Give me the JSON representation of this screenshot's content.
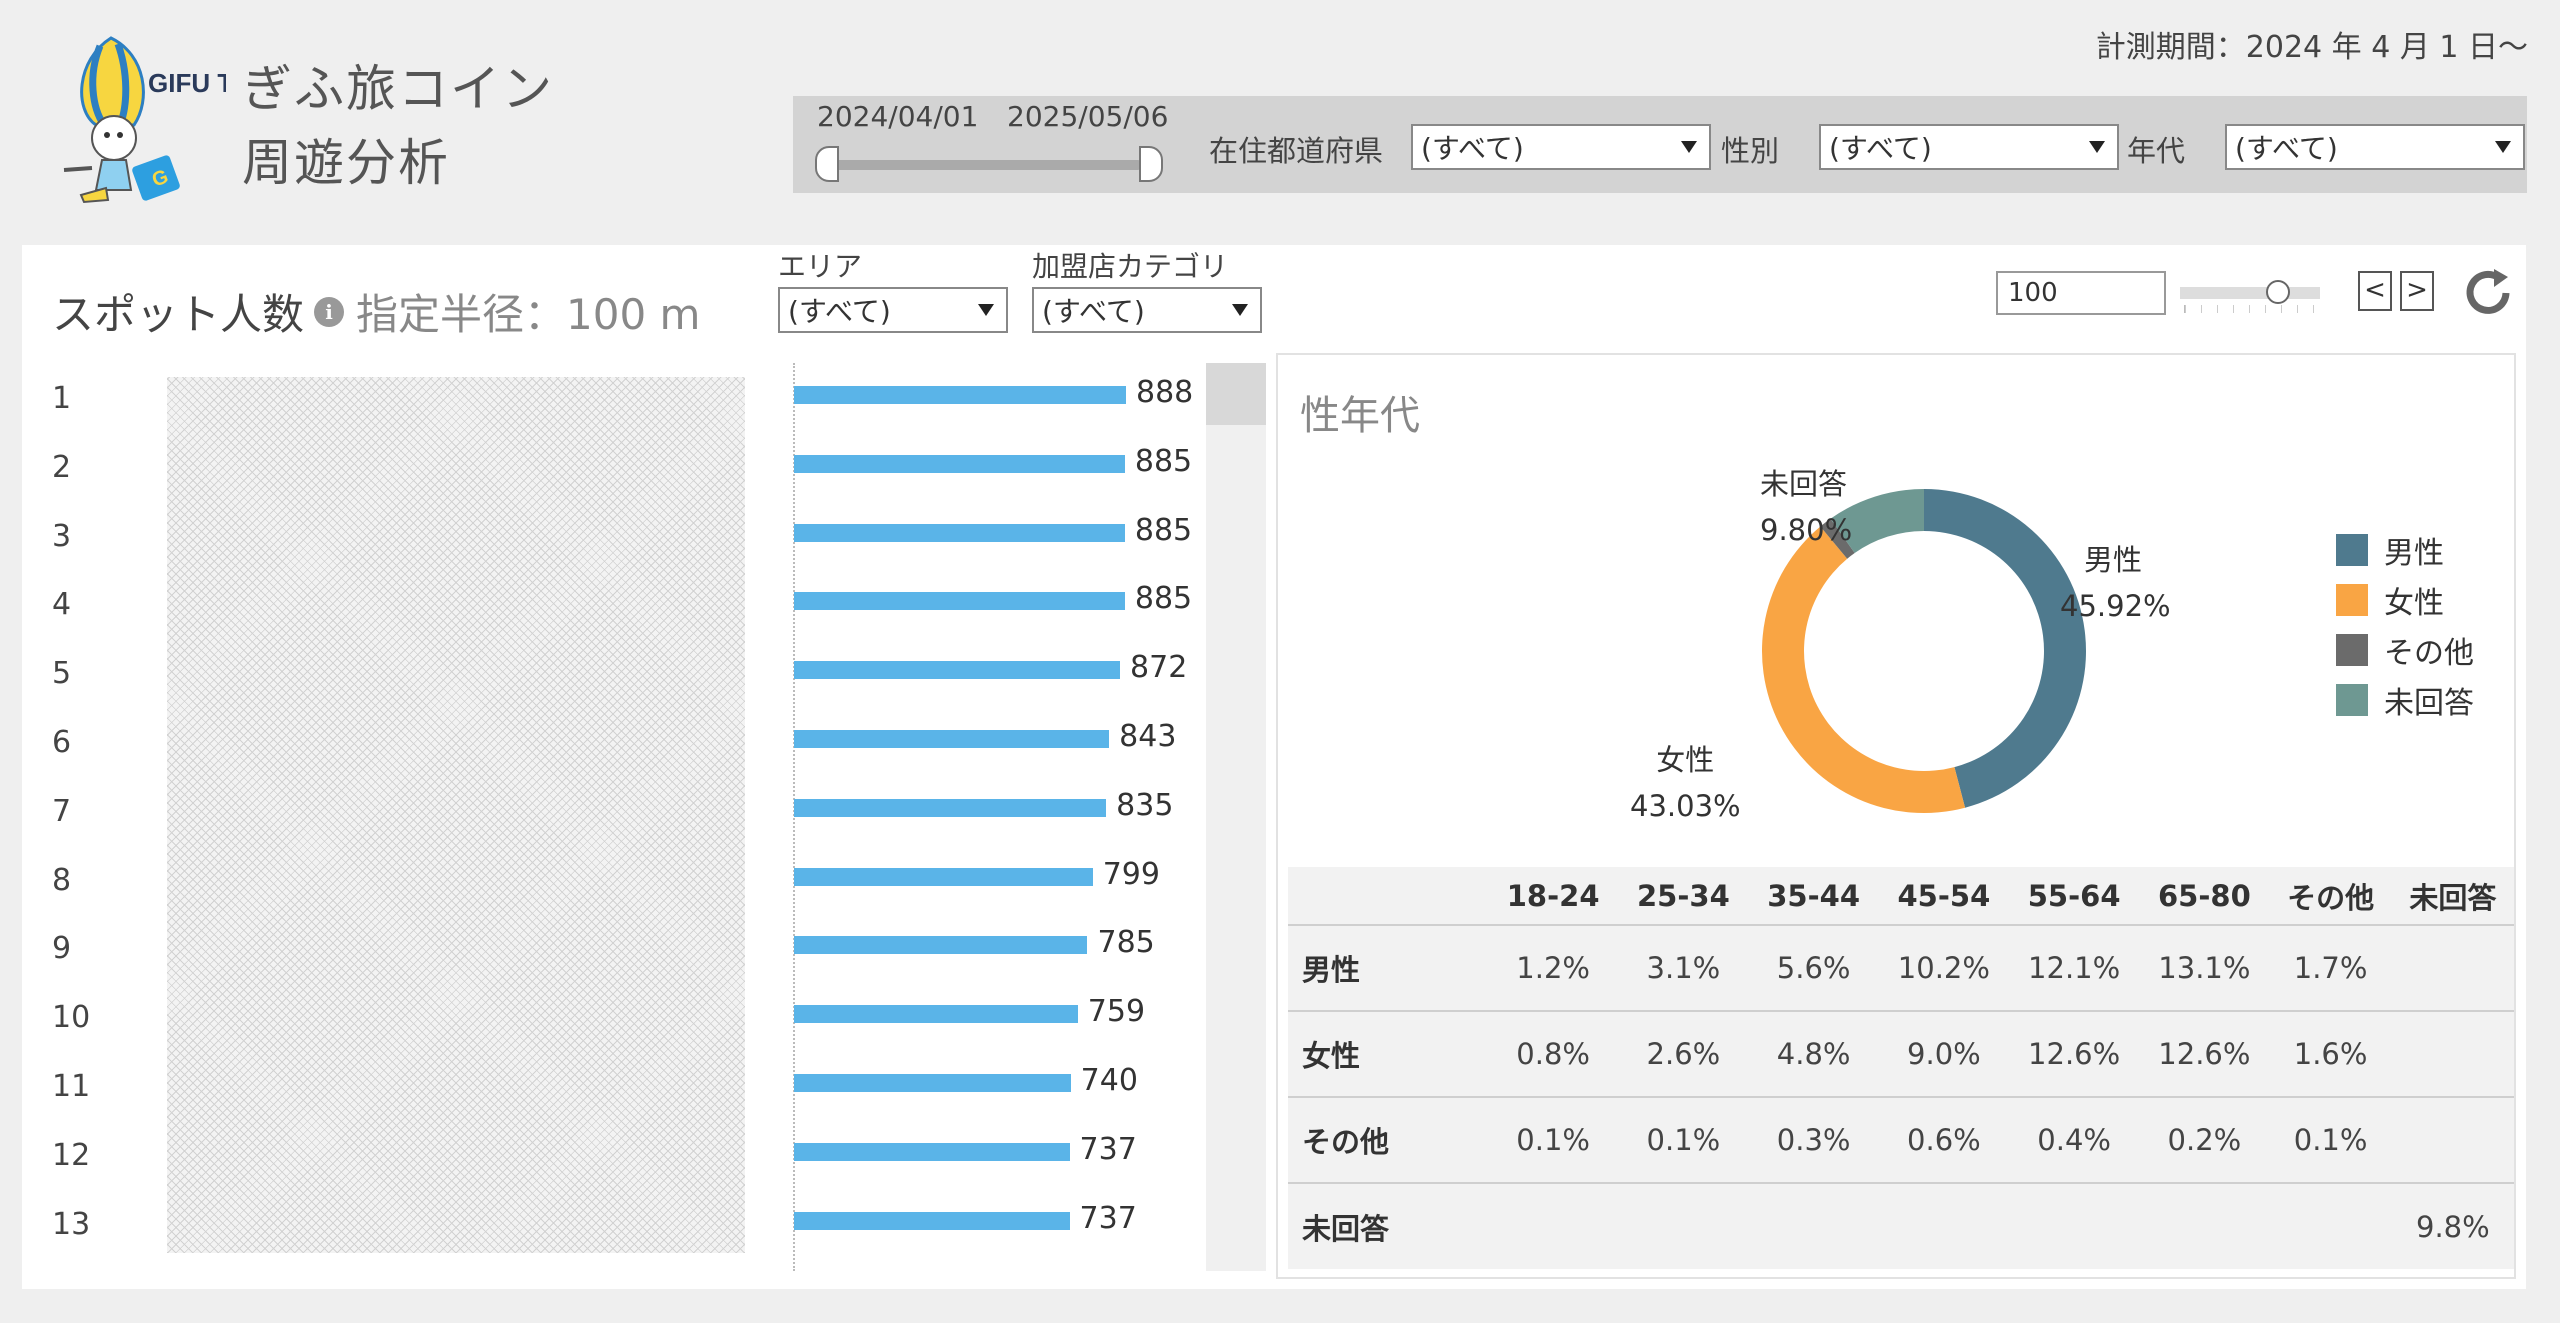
{
  "header": {
    "logo_text": "GIFU TABI",
    "title_line1": "ぎふ旅コイン",
    "title_line2": "周遊分析",
    "period": "計測期間：2024 年 4 月 1 日～"
  },
  "filters": {
    "date_start": "2024/04/01",
    "date_end": "2025/05/06",
    "prefecture_label": "在住都道府県",
    "prefecture_value": "(すべて)",
    "gender_label": "性別",
    "gender_value": "(すべて)",
    "age_label": "年代",
    "age_value": "(すべて)"
  },
  "panel": {
    "title": "スポット人数",
    "info_icon": "i",
    "radius_text": "指定半径：100 m",
    "area_label": "エリア",
    "area_value": "(すべて)",
    "category_label": "加盟店カテゴリ",
    "category_value": "(すべて)",
    "radius_input": "100",
    "prev_button": "<",
    "next_button": ">"
  },
  "spots": [
    {
      "rank": "1",
      "value": 888
    },
    {
      "rank": "2",
      "value": 885
    },
    {
      "rank": "3",
      "value": 885
    },
    {
      "rank": "4",
      "value": 885
    },
    {
      "rank": "5",
      "value": 872
    },
    {
      "rank": "6",
      "value": 843
    },
    {
      "rank": "7",
      "value": 835
    },
    {
      "rank": "8",
      "value": 799
    },
    {
      "rank": "9",
      "value": 785
    },
    {
      "rank": "10",
      "value": 759
    },
    {
      "rank": "11",
      "value": 740
    },
    {
      "rank": "12",
      "value": 737
    },
    {
      "rank": "13",
      "value": 737
    }
  ],
  "demographics": {
    "title": "性年代",
    "donut": [
      {
        "name": "男性",
        "percent": 45.92,
        "label": "45.92%",
        "color": "#4f7a8e"
      },
      {
        "name": "女性",
        "percent": 43.03,
        "label": "43.03%",
        "color": "#f9a544"
      },
      {
        "name": "その他",
        "percent": 1.25,
        "label": "",
        "color": "#6b6b6b"
      },
      {
        "name": "未回答",
        "percent": 9.8,
        "label": "9.80%",
        "color": "#6e9892"
      }
    ],
    "legend": [
      "男性",
      "女性",
      "その他",
      "未回答"
    ],
    "table": {
      "columns": [
        "18-24",
        "25-34",
        "35-44",
        "45-54",
        "55-64",
        "65-80",
        "その他",
        "未回答"
      ],
      "rows": [
        {
          "label": "男性",
          "values": [
            "1.2%",
            "3.1%",
            "5.6%",
            "10.2%",
            "12.1%",
            "13.1%",
            "1.7%",
            ""
          ]
        },
        {
          "label": "女性",
          "values": [
            "0.8%",
            "2.6%",
            "4.8%",
            "9.0%",
            "12.6%",
            "12.6%",
            "1.6%",
            ""
          ]
        },
        {
          "label": "その他",
          "values": [
            "0.1%",
            "0.1%",
            "0.3%",
            "0.6%",
            "0.4%",
            "0.2%",
            "0.1%",
            ""
          ]
        },
        {
          "label": "未回答",
          "values": [
            "",
            "",
            "",
            "",
            "",
            "",
            "",
            "9.8%"
          ]
        }
      ]
    }
  },
  "chart_data": [
    {
      "type": "bar",
      "categories": [
        "1",
        "2",
        "3",
        "4",
        "5",
        "6",
        "7",
        "8",
        "9",
        "10",
        "11",
        "12",
        "13"
      ],
      "values": [
        888,
        885,
        885,
        885,
        872,
        843,
        835,
        799,
        785,
        759,
        740,
        737,
        737
      ],
      "title": "スポット人数"
    },
    {
      "type": "pie",
      "categories": [
        "男性",
        "女性",
        "その他",
        "未回答"
      ],
      "values": [
        45.92,
        43.03,
        1.25,
        9.8
      ],
      "title": "性年代",
      "legend": "right"
    }
  ]
}
